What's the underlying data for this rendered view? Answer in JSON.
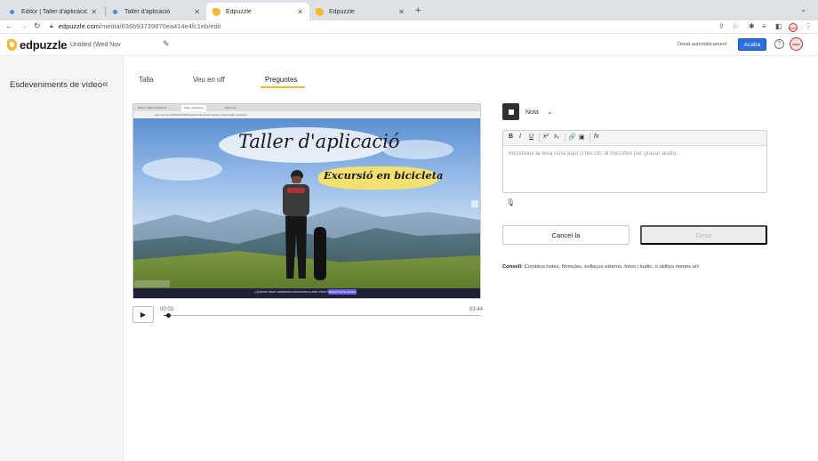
{
  "browser": {
    "tabs": [
      {
        "label": "Editor | Taller d'aplicació",
        "favicon": "chrome-icon",
        "active": false
      },
      {
        "label": "Taller d'aplicació",
        "favicon": "chrome-icon",
        "active": false
      },
      {
        "label": "Edpuzzle",
        "favicon": "edpuzzle-icon",
        "active": true
      },
      {
        "label": "Edpuzzle",
        "favicon": "edpuzzle-icon",
        "active": false
      }
    ],
    "new_tab": "+",
    "url_host": "edpuzzle.com",
    "url_path": "/media/636b93739870ea414e4fc1eb/edit",
    "profile_label": "dom"
  },
  "header": {
    "logo": "edpuzzle",
    "doc_title": "Untitled (Wed Nov",
    "autosave": "Desat automàticament",
    "finish_label": "Acaba",
    "help": "?",
    "avatar_label": "dom"
  },
  "sidebar": {
    "title": "Esdeveniments de vídeo",
    "collapse": "«"
  },
  "tabs": [
    {
      "label": "Talla",
      "active": false
    },
    {
      "label": "Veu en off",
      "active": false
    },
    {
      "label": "Preguntes",
      "active": true
    }
  ],
  "video": {
    "title": "Taller d'aplicació",
    "subtitle": "Excursió en bicicleta",
    "bottom_text": "¿Quieres hacer cambios/correcciones a este vídeo?",
    "bottom_button": "REGISTRATE AHORA",
    "inner_tabs": [
      "Editor | Taller d'aplicació",
      "Taller d'aplicació",
      "Edpuzzle"
    ],
    "inner_url": "www.genial.ly/636b93739870ea414e4fc1eb/interactive-content-taller-aplicacio",
    "current_time": "00:03",
    "total_time": "03:44",
    "progress": 0.013
  },
  "question": {
    "type_label": "Nota",
    "toolbar": [
      "B",
      "I",
      "U",
      "x²",
      "x₂",
      "🔗",
      "▣",
      "fx"
    ],
    "placeholder": "Introdueix la teva nota aquí o fes clic al micròfon per gravar àudio...",
    "cancel_label": "Cancel·la",
    "save_label": "Desa",
    "tip_label": "Consell:",
    "tip_text": "Combina notes, fórmules, enllaços externs, fotos i àudio, o utilitza només un!"
  },
  "colors": {
    "accent": "#f7b731",
    "primary_button": "#2a6fdb"
  }
}
